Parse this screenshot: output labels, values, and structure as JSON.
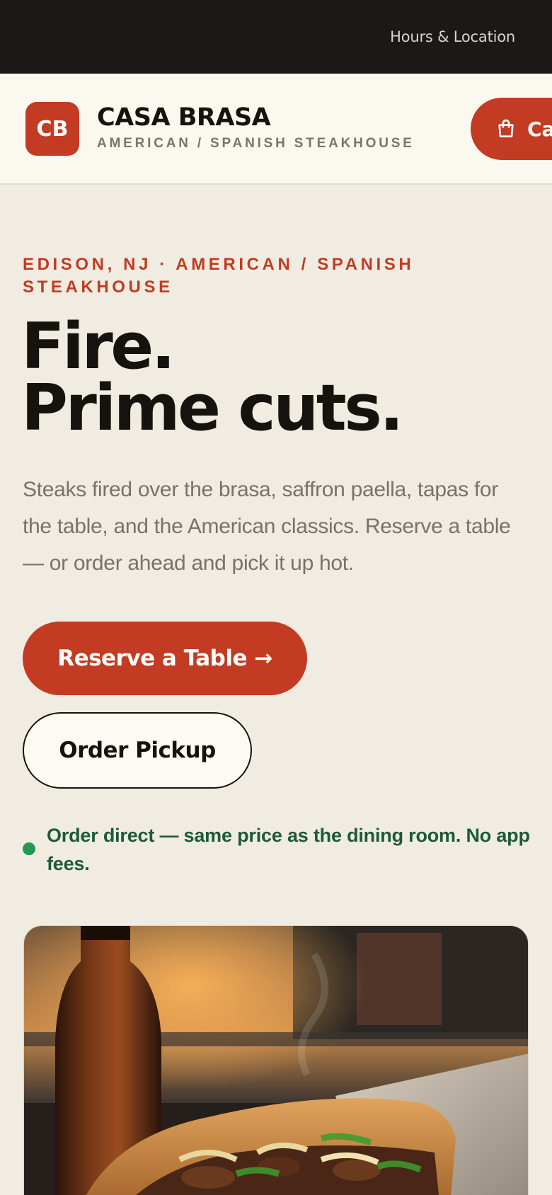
{
  "topbar": {
    "hours_link": "Hours & Location"
  },
  "header": {
    "logo_initials": "CB",
    "brand_name": "CASA BRASA",
    "brand_sub": "AMERICAN / SPANISH STEAKHOUSE",
    "cart_label": "Ca",
    "cart_icon": "shopping-bag-icon"
  },
  "hero": {
    "eyebrow": "EDISON, NJ · AMERICAN / SPANISH STEAKHOUSE",
    "title_line1": "Fire.",
    "title_line2": "Prime cuts.",
    "description": "Steaks fired over the brasa, saffron paella, tapas for the table, and the American classics. Reserve a table — or order ahead and pick it up hot.",
    "reserve_label": "Reserve a Table →",
    "pickup_label": "Order Pickup",
    "note": "Order direct — same price as the dining room. No app fees."
  },
  "colors": {
    "accent": "#c23b22",
    "background": "#f1ece2",
    "header_bg": "#fbf8ef",
    "topbar_bg": "#1b1917",
    "note_green": "#1d5a3c",
    "dot_green": "#1f9a55"
  }
}
